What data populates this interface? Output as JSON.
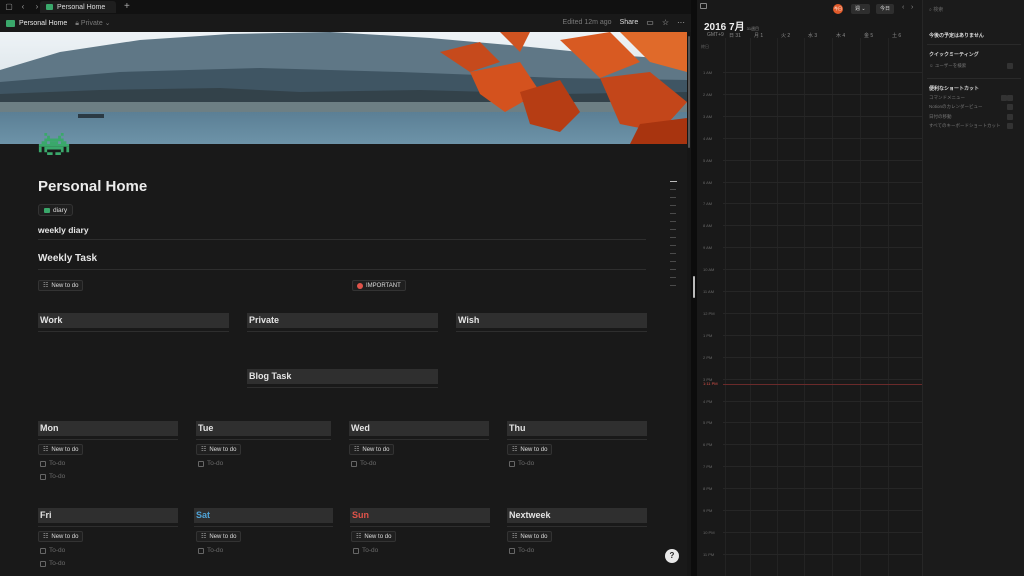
{
  "tab": {
    "title": "Personal Home",
    "new_tab": "+"
  },
  "topbar": {
    "page_title": "Personal Home",
    "privacy": "Private",
    "edited": "Edited 12m ago",
    "share": "Share"
  },
  "page": {
    "title": "Personal Home",
    "tag": "diary",
    "subtitle": "weekly diary",
    "section_weekly": "Weekly Task",
    "new_todo": "New to do",
    "important": "IMPORTANT",
    "columns_top": [
      "Work",
      "Private",
      "Wish"
    ],
    "blog": "Blog Task",
    "days_row1": [
      "Mon",
      "Tue",
      "Wed",
      "Thu"
    ],
    "days_row2": [
      "Fri",
      "Sat",
      "Sun",
      "Nextweek"
    ],
    "todo_placeholder": "To-do",
    "help": "?"
  },
  "calendar": {
    "year_month": "2016 7月",
    "week": "31週目",
    "avatar": "今日",
    "view_label": "週 ⌄",
    "today_label": "今日",
    "tz": "GMT+9",
    "day_headers": [
      "日 31",
      "月 1",
      "火 2",
      "水 3",
      "木 4",
      "金 5",
      "土 6"
    ],
    "allday": "終日",
    "hours": [
      "1 AM",
      "2 AM",
      "3 AM",
      "4 AM",
      "5 AM",
      "6 AM",
      "7 AM",
      "8 AM",
      "9 AM",
      "10 AM",
      "11 AM",
      "12 PM",
      "1 PM",
      "2 PM",
      "3 PM",
      "4 PM",
      "5 PM",
      "6 PM",
      "7 PM",
      "8 PM",
      "9 PM",
      "10 PM",
      "11 PM"
    ],
    "now_label": "1:11 PM"
  },
  "sidepanel": {
    "search": "検索",
    "no_events": "今後の予定はありません",
    "quick_meeting": "クイックミーティング",
    "quick_meeting_item": "ユーザーを検索",
    "shortcuts_title": "便利なショートカット",
    "shortcuts": [
      "コマンドメニュー",
      "Notionのカレンダービュー",
      "日付の移動",
      "すべてのキーボードショートカット"
    ]
  }
}
